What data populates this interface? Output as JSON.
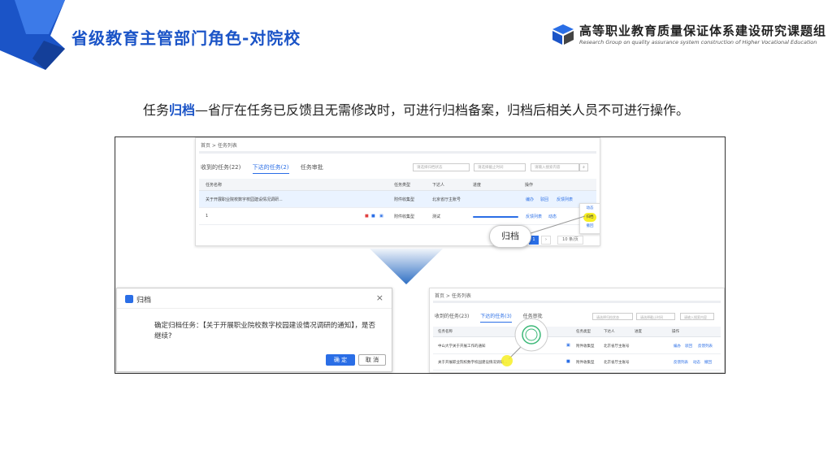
{
  "header": {
    "title": "省级教育主管部门角色-对院校",
    "logo_cn": "高等职业教育质量保证体系建设研究课题组",
    "logo_en": "Research Group on quality assurance system construction of Higher Vocational Education"
  },
  "headline": {
    "prefix": "任务",
    "highlight": "归档",
    "suffix": "—省厅在任务已反馈且无需修改时，可进行归档备案，归档后相关人员不可进行操作。"
  },
  "top_panel": {
    "breadcrumb": "首页 > 任务列表",
    "tabs": [
      "收到的任务(22)",
      "下达的任务(2)",
      "任务审批"
    ],
    "filter_status": "请选择归档状态",
    "filter_date": "请选择截止时间",
    "search_placeholder": "请输入搜索内容",
    "columns": [
      "任务名称",
      "任务类型",
      "下达人",
      "进度",
      "操作"
    ],
    "rows": [
      {
        "name": "关于开展职业院校数字校园建设情况调研...",
        "type": "附件收集型",
        "assigner": "北京省厅主账号",
        "actions": [
          "编办",
          "驳回",
          "反馈列表"
        ]
      },
      {
        "name": "1",
        "type": "附件收集型",
        "assigner": "测试",
        "actions": [
          "反馈列表",
          "动态"
        ]
      }
    ],
    "popup_items": [
      "动态",
      "归档",
      "撤回"
    ],
    "bubble_label": "归档",
    "pager_current": "1",
    "pager_size": "10 条/页"
  },
  "dialog": {
    "title": "归档",
    "close": "×",
    "message": "确定归档任务：【关于开展职业院校数字校园建设情况调研的通知】，是否继续?",
    "ok": "确 定",
    "cancel": "取 消"
  },
  "bottom_panel": {
    "breadcrumb": "首页 > 任务列表",
    "tabs": [
      "收到的任务(23)",
      "下达的任务(3)",
      "任务审批"
    ],
    "filter_status": "请选择归档状态",
    "filter_date": "请选择截止时间",
    "search_placeholder": "请输入搜索内容",
    "columns": [
      "任务名称",
      "任务类型",
      "下达人",
      "进度",
      "操作"
    ],
    "rows": [
      {
        "name": "中山大学关于开展工作的通知",
        "type": "附件收集型",
        "assigner": "北京省厅主账号",
        "actions": [
          "编办",
          "驳回",
          "反馈列表"
        ]
      },
      {
        "name": "关于开展职业院校数字校园建设情况调研...",
        "type": "附件收集型",
        "assigner": "北京省厅主账号",
        "actions": [
          "反馈列表",
          "动态",
          "撤回"
        ]
      }
    ]
  },
  "colors": {
    "brand": "#1b54c7",
    "accent": "#2a6ee6",
    "highlight": "#f7ef24"
  }
}
